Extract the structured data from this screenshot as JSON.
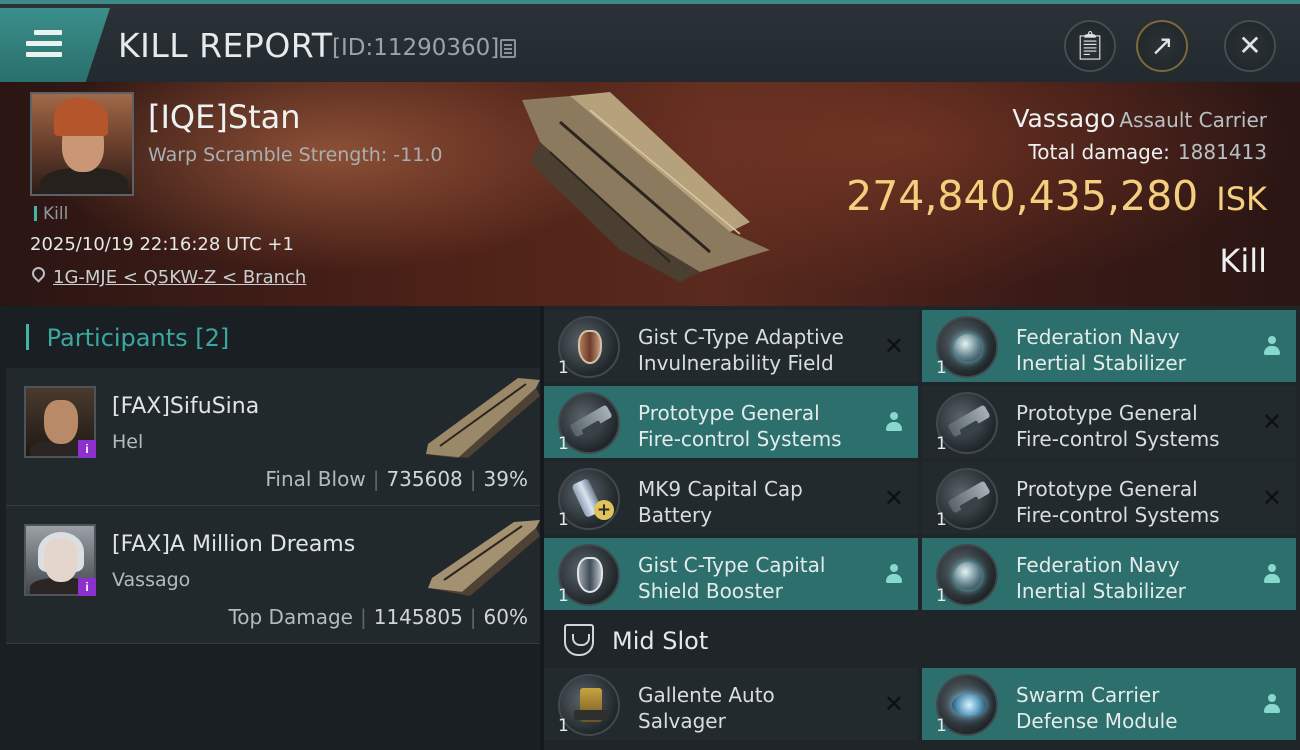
{
  "header": {
    "title": "KILL REPORT",
    "report_id": "[ID:11290360]"
  },
  "victim": {
    "name": "[IQE]Stan",
    "warp_scramble": "Warp Scramble Strength: -11.0",
    "tag": "Kill",
    "datetime": "2025/10/19 22:16:28 UTC +1",
    "location": "1G-MJE < Q5KW-Z < Branch",
    "ship_name": "Vassago",
    "ship_class": "Assault Carrier",
    "total_damage_label": "Total damage:",
    "total_damage": "1881413",
    "isk_value": "274,840,435,280",
    "isk_unit": "ISK",
    "result": "Kill"
  },
  "participants": {
    "label": "Participants",
    "count": "[2]",
    "items": [
      {
        "name": "[FAX]SifuSina",
        "ship": "Hel",
        "role": "Final Blow",
        "damage": "735608",
        "percent": "39%"
      },
      {
        "name": "[FAX]A Million Dreams",
        "ship": "Vassago",
        "role": "Top Damage",
        "damage": "1145805",
        "percent": "60%"
      }
    ]
  },
  "modules": [
    {
      "name_l1": "Gist C-Type Adaptive",
      "name_l2": "Invulnerability Field",
      "qty": "1",
      "state": "destroyed",
      "icon": "shield-module-icon"
    },
    {
      "name_l1": "Federation Navy",
      "name_l2": "Inertial Stabilizer",
      "qty": "1",
      "state": "dropped",
      "icon": "inertial-stabilizer-icon"
    },
    {
      "name_l1": "Prototype General",
      "name_l2": "Fire-control Systems",
      "qty": "1",
      "state": "dropped",
      "icon": "fire-control-icon"
    },
    {
      "name_l1": "Prototype General",
      "name_l2": "Fire-control Systems",
      "qty": "1",
      "state": "destroyed",
      "icon": "fire-control-icon"
    },
    {
      "name_l1": "MK9 Capital Cap",
      "name_l2": "Battery",
      "qty": "1",
      "state": "destroyed",
      "icon": "cap-battery-icon"
    },
    {
      "name_l1": "Prototype General",
      "name_l2": "Fire-control Systems",
      "qty": "1",
      "state": "destroyed",
      "icon": "fire-control-icon"
    },
    {
      "name_l1": "Gist C-Type Capital",
      "name_l2": "Shield Booster",
      "qty": "1",
      "state": "dropped",
      "icon": "shield-booster-icon"
    },
    {
      "name_l1": "Federation Navy",
      "name_l2": "Inertial Stabilizer",
      "qty": "1",
      "state": "dropped",
      "icon": "inertial-stabilizer-icon"
    }
  ],
  "mid_slot": {
    "label": "Mid Slot",
    "items": [
      {
        "name_l1": "Gallente Auto",
        "name_l2": "Salvager",
        "qty": "1",
        "state": "destroyed",
        "icon": "salvager-icon"
      },
      {
        "name_l1": "Swarm Carrier",
        "name_l2": "Defense Module",
        "qty": "1",
        "state": "dropped",
        "icon": "defense-module-icon"
      }
    ]
  },
  "colors": {
    "accent_teal": "#2d6f6c",
    "isk_gold": "#f3cf7e",
    "corp_badge": "#8e2fd0"
  }
}
